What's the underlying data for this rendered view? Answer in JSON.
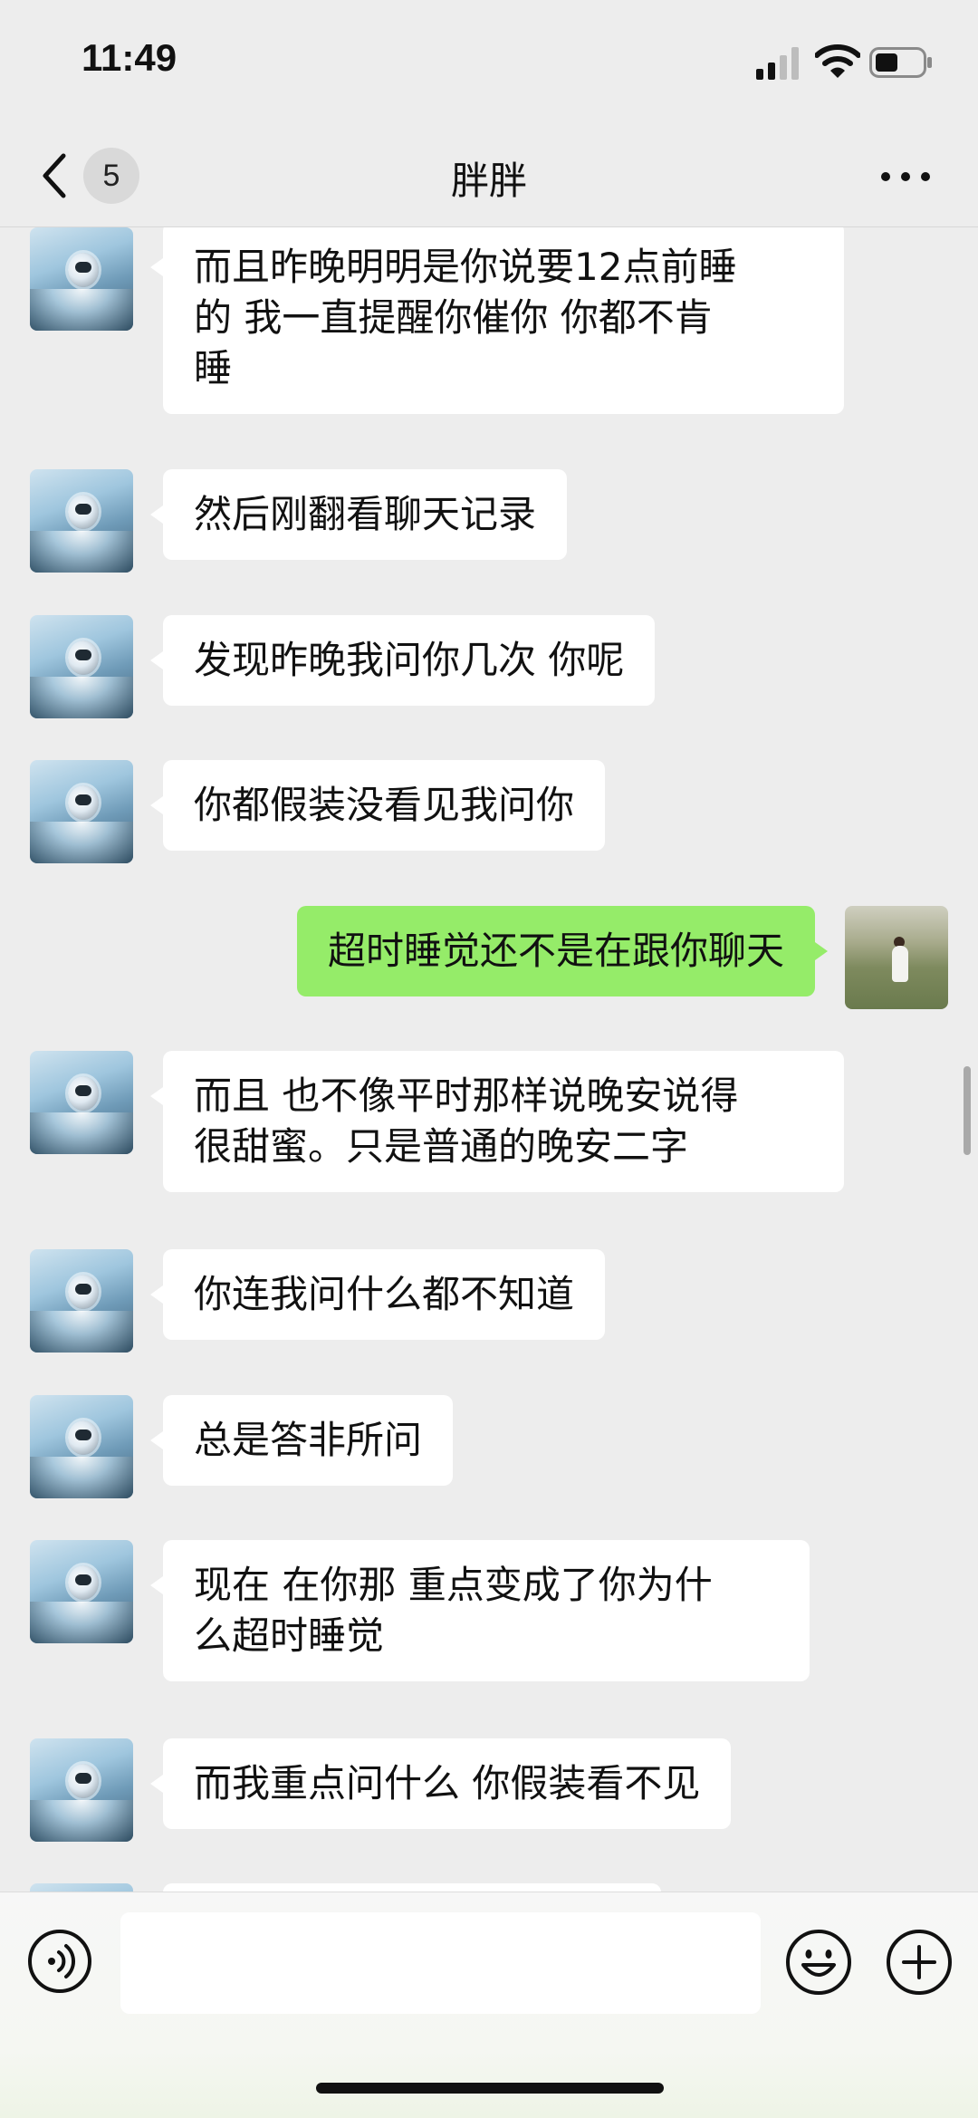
{
  "status_bar": {
    "time": "11:49",
    "icons": [
      "cellular-signal-icon",
      "wifi-icon",
      "battery-icon"
    ]
  },
  "header": {
    "back_icon": "chevron-left-icon",
    "unread_count": "5",
    "title": "胖胖",
    "more_icon": "more-dots-icon"
  },
  "messages": [
    {
      "sender": "other",
      "text": "而且昨晚明明是你说要12点前睡\n的 我一直提醒你催你 你都不肯\n睡"
    },
    {
      "sender": "other",
      "text": "然后刚翻看聊天记录"
    },
    {
      "sender": "other",
      "text": "发现昨晚我问你几次 你呢"
    },
    {
      "sender": "other",
      "text": "你都假装没看见我问你"
    },
    {
      "sender": "me",
      "text": "超时睡觉还不是在跟你聊天"
    },
    {
      "sender": "other",
      "text": "而且 也不像平时那样说晚安说得\n很甜蜜。只是普通的晚安二字"
    },
    {
      "sender": "other",
      "text": "你连我问什么都不知道"
    },
    {
      "sender": "other",
      "text": "总是答非所问"
    },
    {
      "sender": "other",
      "text": "现在 在你那 重点变成了你为什\n么超时睡觉"
    },
    {
      "sender": "other",
      "text": "而我重点问什么 你假装看不见"
    },
    {
      "sender": "other",
      "text": ""
    }
  ],
  "input_bar": {
    "voice_icon": "voice-icon",
    "input_value": "",
    "emoji_icon": "emoji-icon",
    "plus_icon": "plus-icon"
  },
  "colors": {
    "background": "#ededed",
    "incoming_bubble": "#ffffff",
    "outgoing_bubble": "#95ec69"
  }
}
